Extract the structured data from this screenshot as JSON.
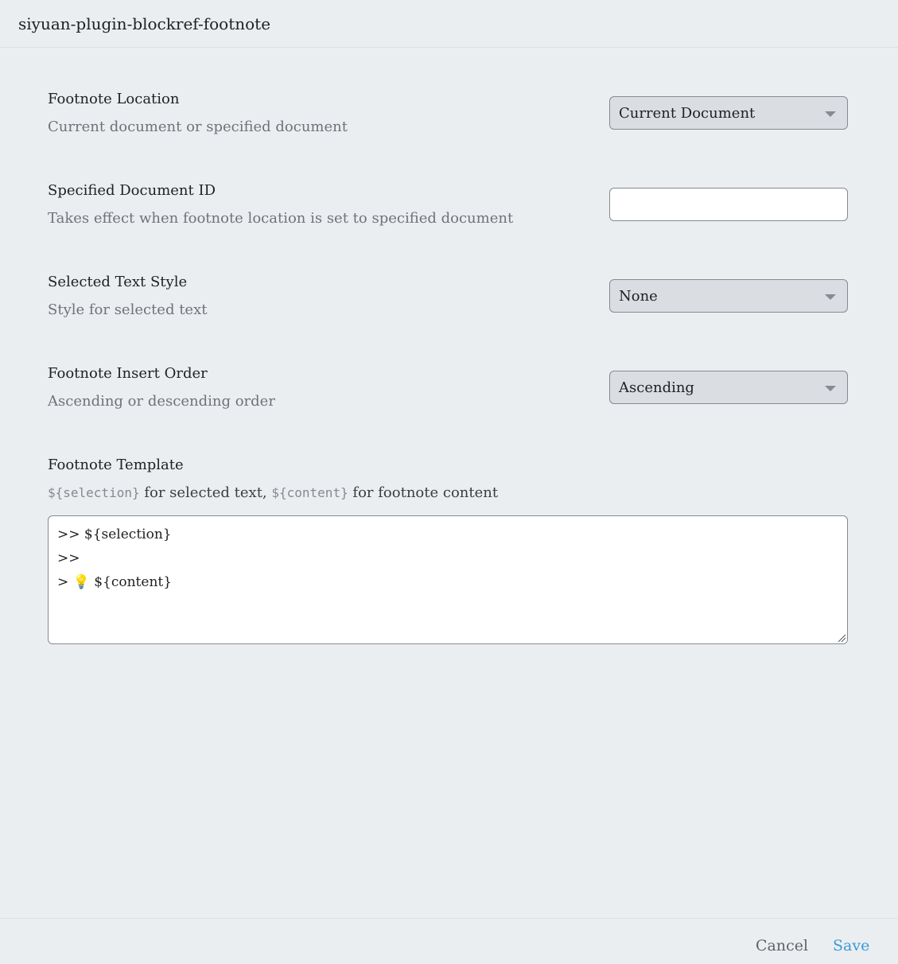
{
  "header": {
    "title": "siyuan-plugin-blockref-footnote"
  },
  "settings": [
    {
      "label": "Footnote Location",
      "description": "Current document or specified document",
      "control": "select",
      "value": "Current Document"
    },
    {
      "label": "Specified Document ID",
      "description": "Takes effect when footnote location is set to specified document",
      "control": "input",
      "value": "",
      "placeholder": ""
    },
    {
      "label": "Selected Text Style",
      "description": "Style for selected text",
      "control": "select",
      "value": "None"
    },
    {
      "label": "Footnote Insert Order",
      "description": "Ascending or descending order",
      "control": "select",
      "value": "Ascending"
    }
  ],
  "template": {
    "label": "Footnote Template",
    "desc_code1": "${selection}",
    "desc_text1": " for selected text, ",
    "desc_code2": "${content}",
    "desc_text2": " for footnote content",
    "value": ">> ${selection}\n>>\n> 💡 ${content}"
  },
  "footer": {
    "cancel_label": "Cancel",
    "save_label": "Save"
  },
  "colors": {
    "background": "#ebeef1",
    "save_accent": "#3b9bd6",
    "select_bg": "#dadee3"
  }
}
